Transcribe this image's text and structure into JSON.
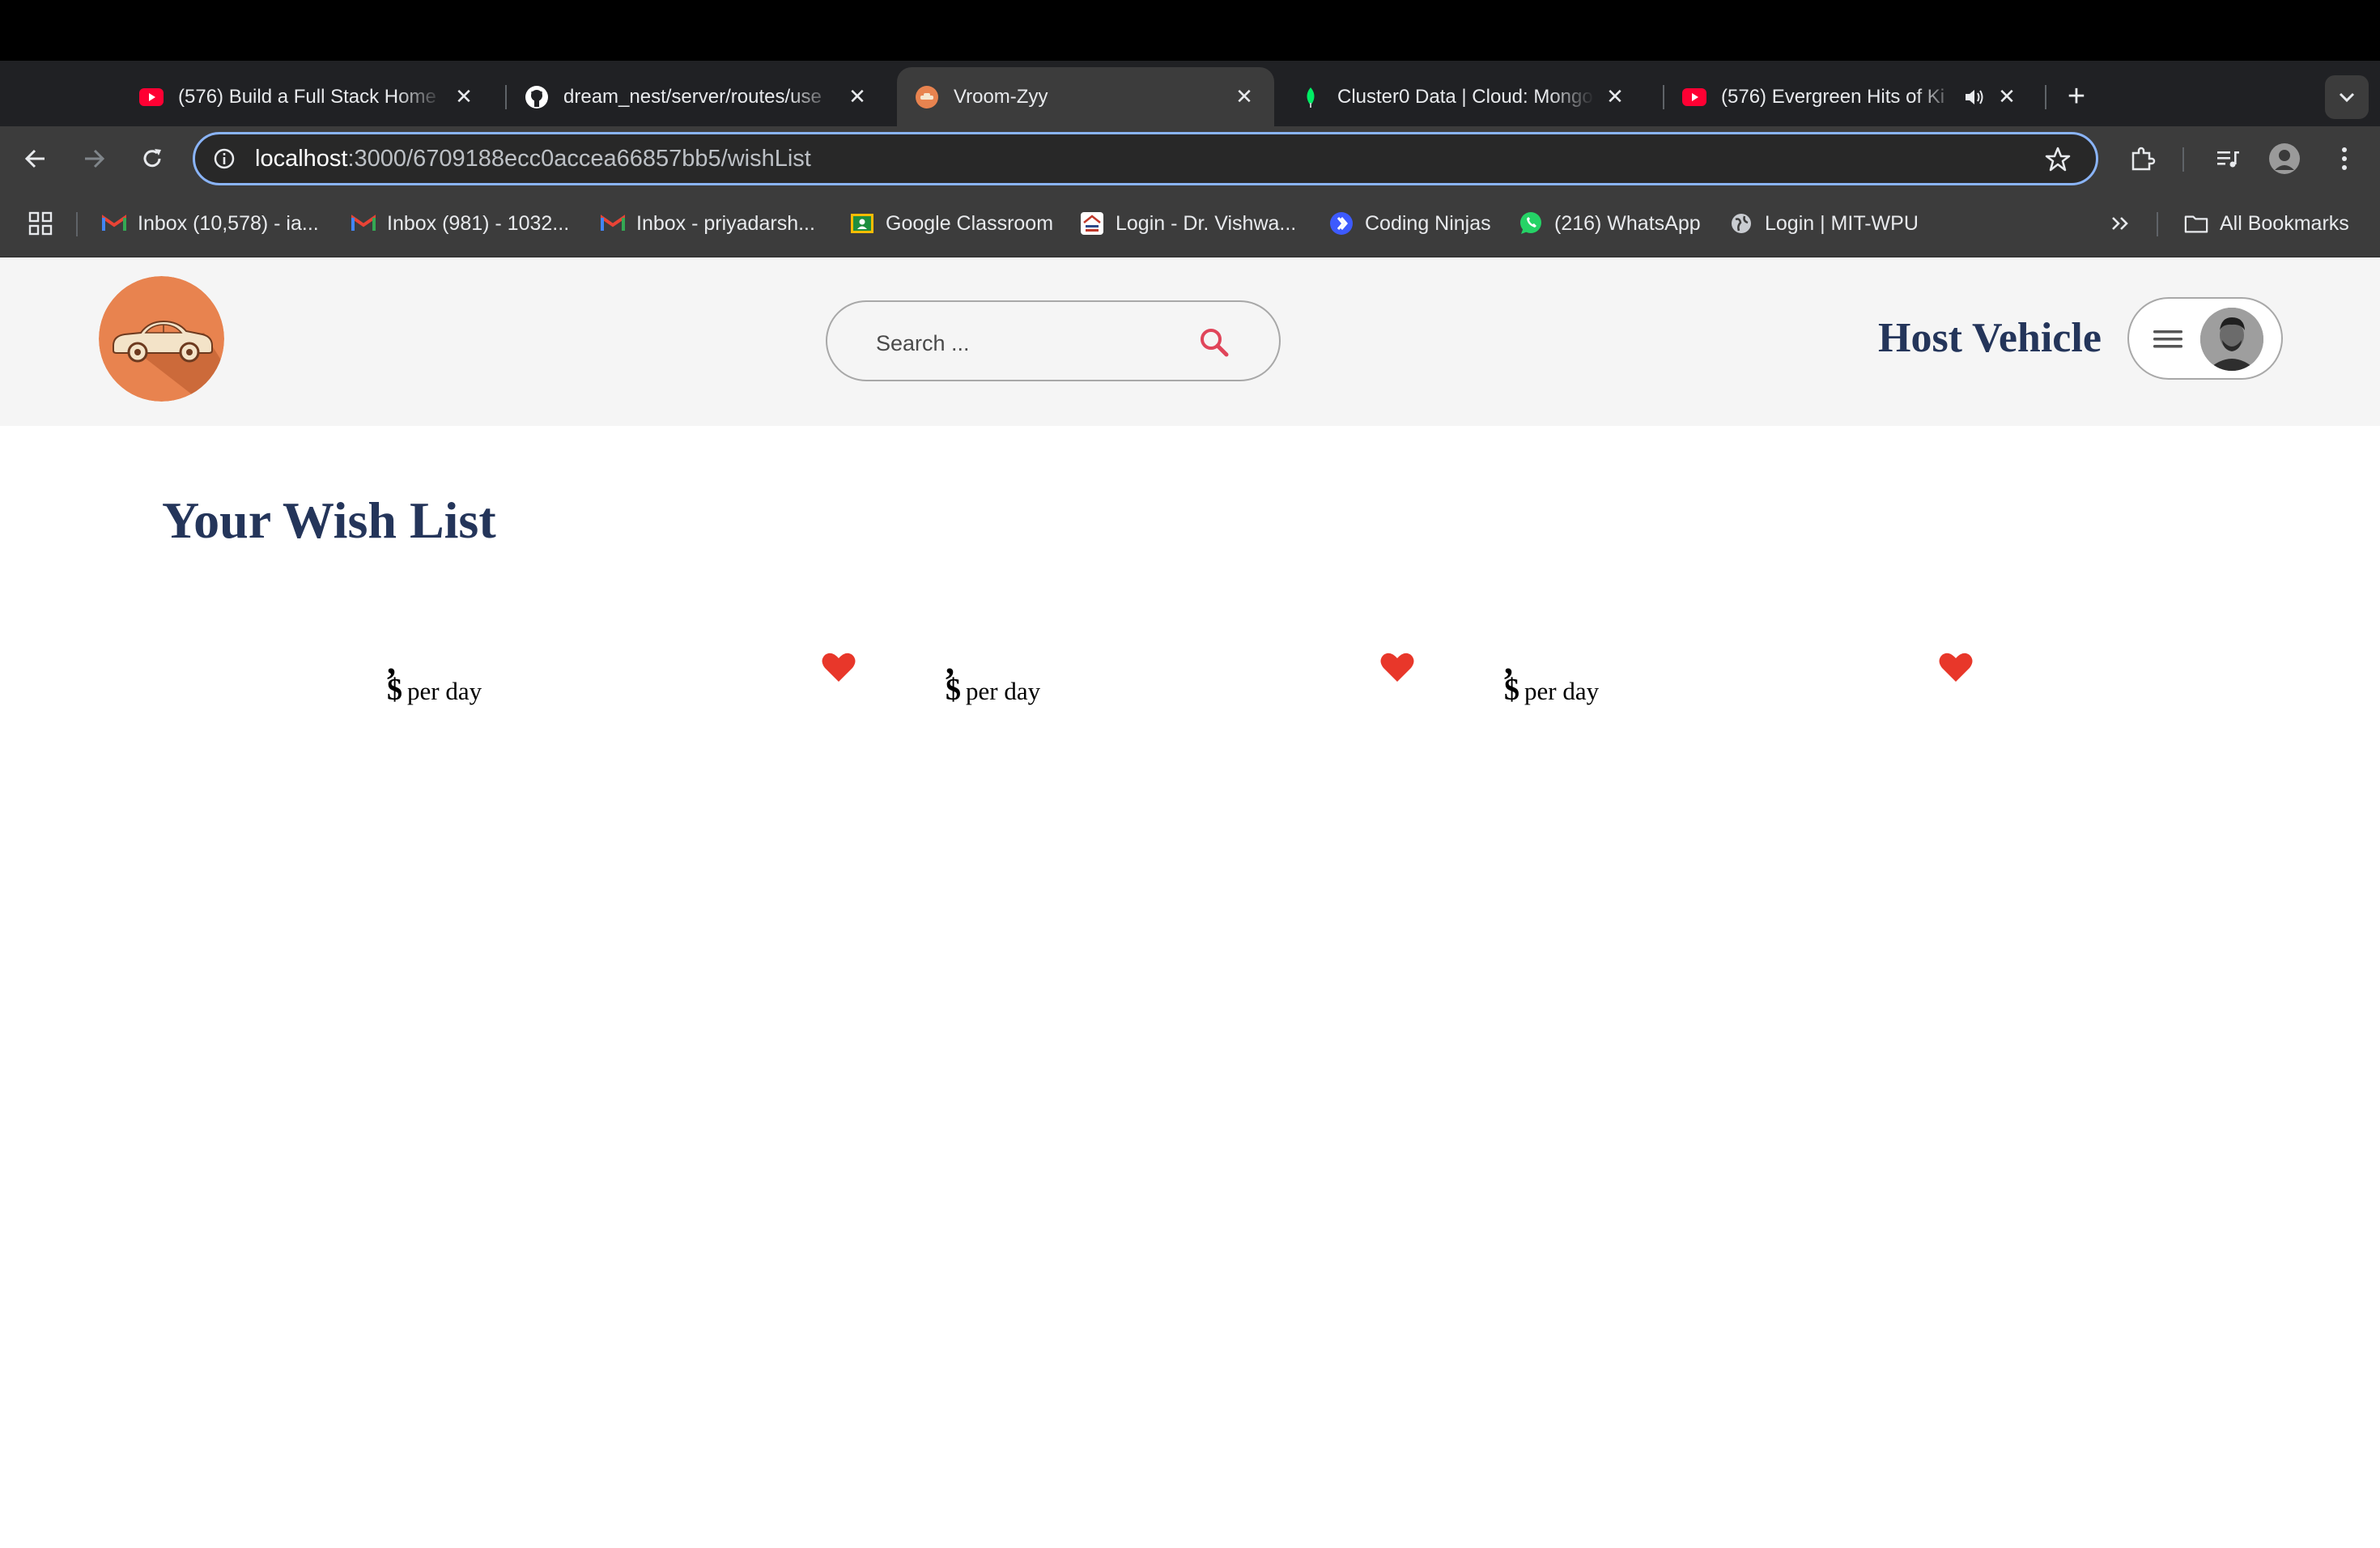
{
  "browser": {
    "tabs": [
      {
        "title": "(576) Build a Full Stack Home",
        "favicon": "youtube-icon",
        "active": false
      },
      {
        "title": "dream_nest/server/routes/use",
        "favicon": "github-icon",
        "active": false
      },
      {
        "title": "Vroom-Zyy",
        "favicon": "vroom-zyy-favicon",
        "active": true
      },
      {
        "title": "Cluster0 Data | Cloud: Mongo",
        "favicon": "mongodb-leaf-icon",
        "active": false
      },
      {
        "title": "(576) Evergreen Hits of Ki",
        "favicon": "youtube-icon",
        "active": false,
        "audio": true
      }
    ],
    "url_host": "localhost",
    "url_path": ":3000/6709188ecc0accea66857bb5/wishList",
    "bookmarks": [
      {
        "label": "Inbox (10,578) - ia...",
        "icon": "gmail-icon"
      },
      {
        "label": "Inbox (981) - 1032...",
        "icon": "gmail-icon"
      },
      {
        "label": "Inbox - priyadarsh...",
        "icon": "gmail-icon"
      },
      {
        "label": "Google Classroom",
        "icon": "google-classroom-icon"
      },
      {
        "label": "Login - Dr. Vishwa...",
        "icon": "university-icon"
      },
      {
        "label": "Coding Ninjas",
        "icon": "coding-ninjas-icon"
      },
      {
        "label": "(216) WhatsApp",
        "icon": "whatsapp-icon"
      },
      {
        "label": "Login | MIT-WPU",
        "icon": "globe-icon"
      }
    ],
    "all_bookmarks_label": "All Bookmarks"
  },
  "header": {
    "search_placeholder": "Search ...",
    "host_link": "Host Vehicle"
  },
  "main": {
    "title": "Your Wish List",
    "cards": [
      {
        "comma": ",",
        "currency": "$",
        "per_label": "per day",
        "liked": true
      },
      {
        "comma": ",",
        "currency": "$",
        "per_label": "per day",
        "liked": true
      },
      {
        "comma": ",",
        "currency": "$",
        "per_label": "per day",
        "liked": true
      }
    ]
  },
  "colors": {
    "brand_navy": "#24355a",
    "logo_orange": "#e8834f",
    "heart_red": "#e8372a",
    "search_icon_red": "#e0455a"
  }
}
